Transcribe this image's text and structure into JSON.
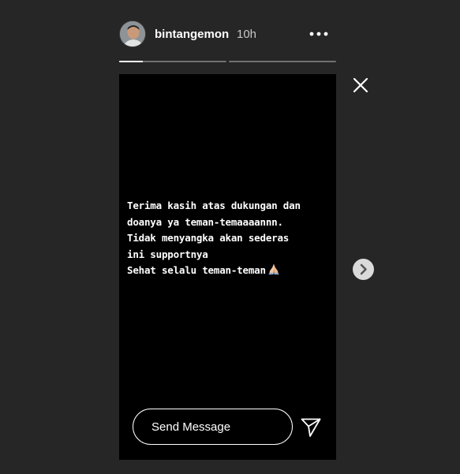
{
  "header": {
    "username": "bintangemon",
    "timestamp": "10h",
    "avatar_icon": "user-avatar",
    "more_icon": "ellipsis-horizontal-icon"
  },
  "progress": {
    "segments": 2,
    "current_segment_progress": 0.22
  },
  "story": {
    "lines": [
      "Terima kasih atas dukungan dan",
      "doanya ya teman-temaaaannn.",
      "Tidak menyangka akan sederas",
      "ini supportnya",
      "Sehat selalu teman-teman"
    ],
    "emoji": "folded-hands",
    "background": "#000000"
  },
  "reply": {
    "placeholder": "Send Message",
    "send_icon": "paper-plane-icon"
  },
  "controls": {
    "close_icon": "close-icon",
    "next_icon": "chevron-right-icon"
  },
  "colors": {
    "page_background": "#262626",
    "text": "#ffffff",
    "muted_text": "#c7c7c7"
  }
}
